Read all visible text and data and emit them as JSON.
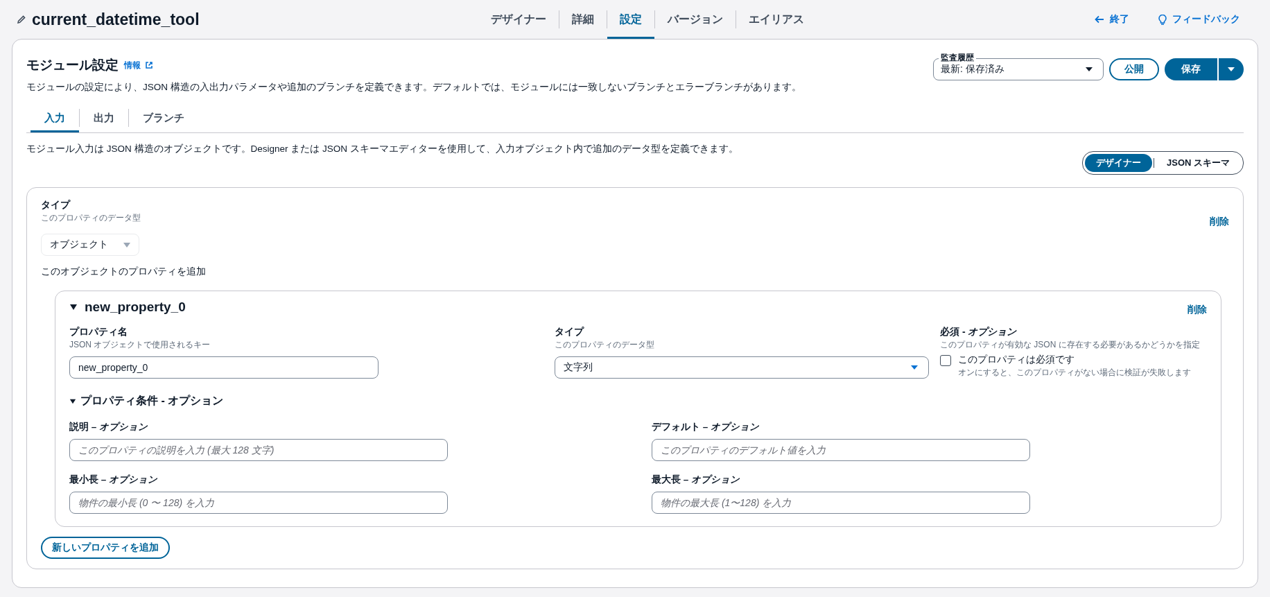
{
  "header": {
    "title": "current_datetime_tool",
    "exit": "終了",
    "feedback": "フィードバック",
    "tabs": [
      {
        "label": "デザイナー",
        "selected": false
      },
      {
        "label": "詳細",
        "selected": false
      },
      {
        "label": "設定",
        "selected": true
      },
      {
        "label": "バージョン",
        "selected": false
      },
      {
        "label": "エイリアス",
        "selected": false
      }
    ]
  },
  "module": {
    "title": "モジュール設定",
    "info": "情報",
    "description": "モジュールの設定により、JSON 構造の入出力パラメータや追加のブランチを定義できます。デフォルトでは、モジュールには一致しないブランチとエラーブランチがあります。",
    "audit": {
      "label": "監査履歴",
      "value": "最新: 保存済み"
    },
    "publish": "公開",
    "save": "保存",
    "tabs": [
      {
        "label": "入力",
        "selected": true
      },
      {
        "label": "出力",
        "selected": false
      },
      {
        "label": "ブランチ",
        "selected": false
      }
    ],
    "input_description": "モジュール入力は JSON 構造のオブジェクトです。Designer または JSON スキーマエディターを使用して、入力オブジェクト内で追加のデータ型を定義できます。",
    "mode_toggle": [
      {
        "label": "デザイナー",
        "selected": true
      },
      {
        "label": "JSON スキーマ",
        "selected": false
      }
    ],
    "type_panel": {
      "label": "タイプ",
      "hint": "このプロパティのデータ型",
      "value": "オブジェクト",
      "delete": "削除",
      "properties_label": "このオブジェクトのプロパティを追加",
      "properties": [
        {
          "name": "new_property_0",
          "expanded": true,
          "delete": "削除",
          "name_field": {
            "label": "プロパティ名",
            "hint": "JSON オブジェクトで使用されるキー",
            "value": "new_property_0"
          },
          "type_field": {
            "label": "タイプ",
            "hint": "このプロパティのデータ型",
            "value": "文字列"
          },
          "required": {
            "label": "必須 - *オプション*",
            "hint": "このプロパティが有効な JSON に存在する必要があるかどうかを指定",
            "checkbox_label": "このプロパティは必須です",
            "checkbox_hint": "オンにすると、このプロパティがない場合に検証が失敗します",
            "checked": false
          },
          "conditions": {
            "title": "プロパティ条件 - オプション",
            "expanded": true,
            "fields": [
              {
                "label": "説明 – *オプション*",
                "placeholder": "このプロパティの説明を入力 (最大 128 文字)"
              },
              {
                "label": "デフォルト – *オプション*",
                "placeholder": "このプロパティのデフォルト値を入力"
              },
              {
                "label": "最小長 – *オプション*",
                "placeholder": "物件の最小長 (0 〜 128) を入力"
              },
              {
                "label": "最大長 – *オプション*",
                "placeholder": "物件の最大長 (1〜128) を入力"
              }
            ]
          }
        }
      ],
      "add_button": "新しいプロパティを追加"
    }
  }
}
